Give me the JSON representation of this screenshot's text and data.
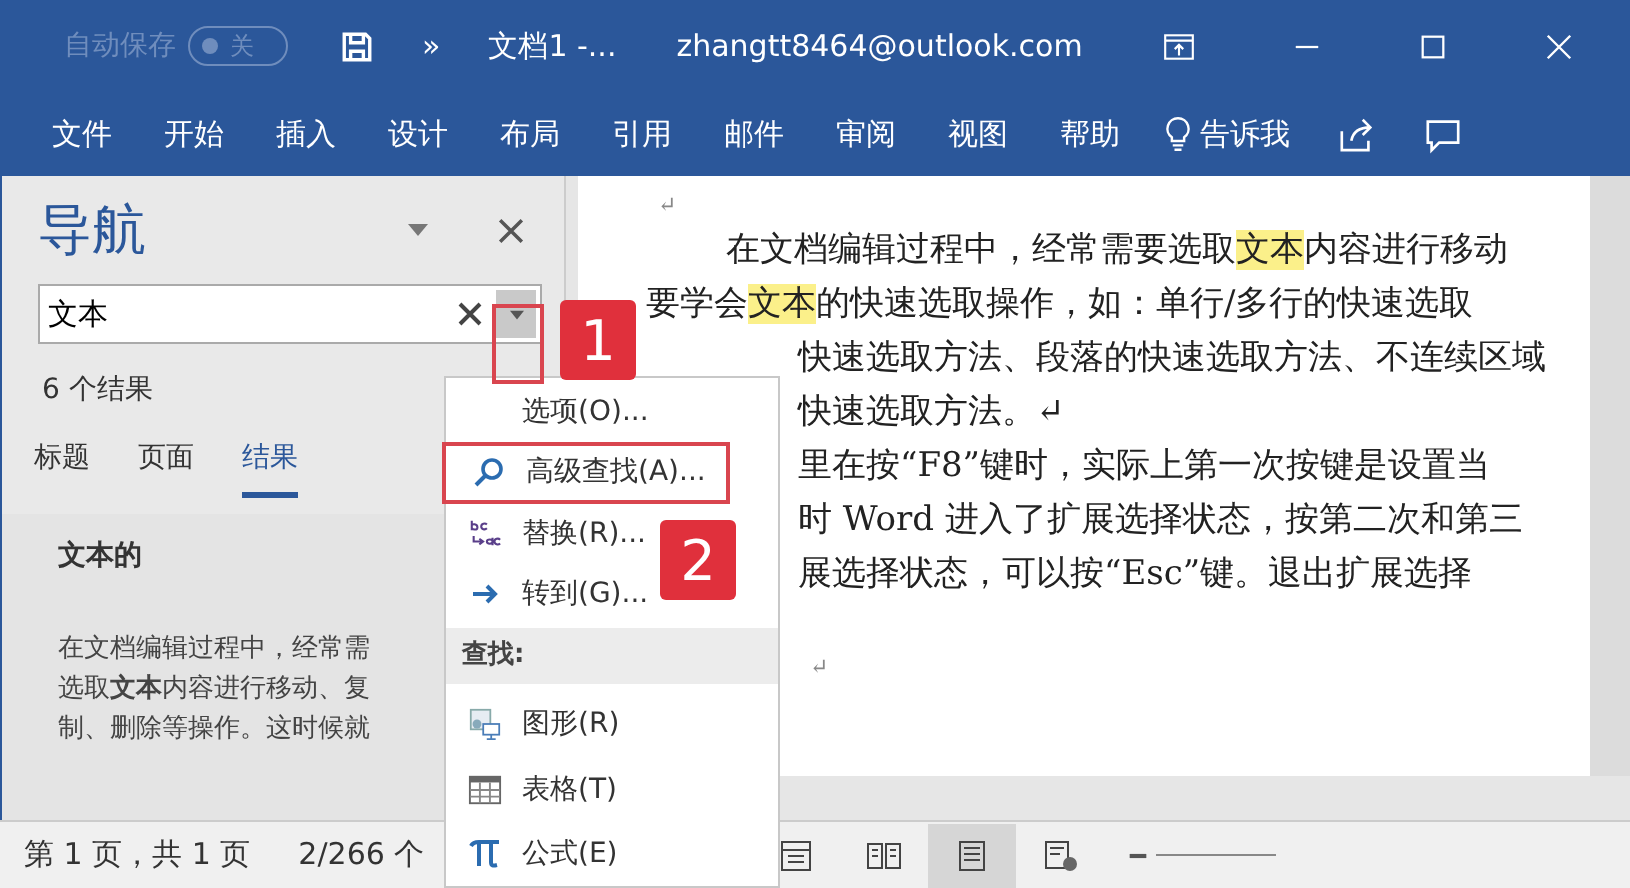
{
  "title_bar": {
    "autosave_label": "自动保存",
    "autosave_toggle": {
      "label": "关",
      "on": false
    },
    "overflow": "»",
    "document_title": "文档1 -...",
    "account": "zhangtt8464@outlook.com"
  },
  "ribbon_tabs": [
    {
      "label": "文件"
    },
    {
      "label": "开始"
    },
    {
      "label": "插入"
    },
    {
      "label": "设计"
    },
    {
      "label": "布局"
    },
    {
      "label": "引用"
    },
    {
      "label": "邮件"
    },
    {
      "label": "审阅"
    },
    {
      "label": "视图"
    },
    {
      "label": "帮助"
    }
  ],
  "tell_me": "告诉我",
  "navigation": {
    "title": "导航",
    "search_value": "文本",
    "result_count": "6 个结果",
    "tabs": [
      {
        "label": "标题",
        "selected": false
      },
      {
        "label": "页面",
        "selected": false
      },
      {
        "label": "结果",
        "selected": true
      }
    ],
    "result_heading": "文本的",
    "result_snippet": [
      "在文档编辑过程中，经常需",
      "选取**文本**内容进行移动、复",
      "制、删除等操作。这时候就"
    ]
  },
  "search_menu": {
    "items": [
      {
        "kind": "item",
        "label": "选项(O)...",
        "annotated": false
      },
      {
        "kind": "item",
        "label": "高级查找(A)...",
        "annotated": true
      },
      {
        "kind": "item",
        "label": "替换(R)...",
        "annotated": false
      },
      {
        "kind": "item",
        "label": "转到(G)...",
        "annotated": false
      },
      {
        "kind": "header",
        "label": "查找:"
      },
      {
        "kind": "item",
        "label": "图形(R)",
        "annotated": false
      },
      {
        "kind": "item",
        "label": "表格(T)",
        "annotated": false
      },
      {
        "kind": "item",
        "label": "公式(E)",
        "annotated": false
      }
    ]
  },
  "callouts": [
    "1",
    "2"
  ],
  "document": {
    "lines": [
      {
        "kind": "mark",
        "covered": false,
        "segments": [
          {
            "text": "↵",
            "highlighted": false
          }
        ]
      },
      {
        "kind": "first",
        "covered": false,
        "segments": [
          {
            "text": "在文档编辑过程中，经常需要选取",
            "highlighted": false
          },
          {
            "text": "文本",
            "highlighted": true
          },
          {
            "text": "内容进行移动",
            "highlighted": false
          }
        ]
      },
      {
        "kind": "text",
        "covered": false,
        "segments": [
          {
            "text": "要学会",
            "highlighted": false
          },
          {
            "text": "文本",
            "highlighted": true
          },
          {
            "text": "的快速选取操作，如：单行/多行的快速选取",
            "highlighted": false
          }
        ]
      },
      {
        "kind": "text",
        "covered": true,
        "segments": [
          {
            "text": "快速选取方法、段落的快速选取方法、不连续区域",
            "highlighted": false
          }
        ]
      },
      {
        "kind": "text",
        "covered": true,
        "segments": [
          {
            "text": "快速选取方法。↵",
            "highlighted": false
          }
        ]
      },
      {
        "kind": "text",
        "covered": true,
        "segments": [
          {
            "text": "里在按“F8”键时，实际上第一次按键是设置当",
            "highlighted": false
          }
        ]
      },
      {
        "kind": "text",
        "covered": true,
        "segments": [
          {
            "text": "时 Word 进入了扩展选择状态，按第二次和第三",
            "highlighted": false
          }
        ]
      },
      {
        "kind": "text",
        "covered": true,
        "segments": [
          {
            "text": "展选择状态，可以按“Esc”键。退出扩展选择",
            "highlighted": false
          }
        ]
      },
      {
        "kind": "mark",
        "covered": true,
        "segments": [
          {
            "text": "↵",
            "highlighted": false
          }
        ]
      }
    ]
  },
  "status_bar": {
    "page": "第 1 页，共 1 页",
    "words": "2/266 个",
    "views": [
      {
        "kind": "focus",
        "selected": false
      },
      {
        "kind": "read",
        "selected": false
      },
      {
        "kind": "print",
        "selected": true
      },
      {
        "kind": "web",
        "selected": false
      }
    ]
  }
}
